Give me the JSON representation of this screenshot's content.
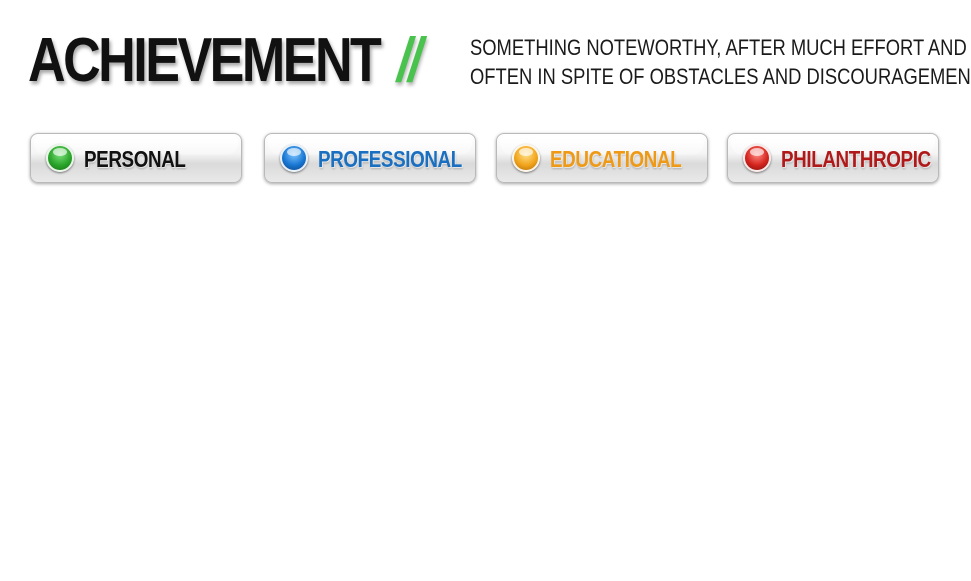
{
  "header": {
    "title": "ACHIEVEMENT",
    "separator": "//",
    "definition_line1": "SOMETHING NOTEWORTHY, AFTER MUCH EFFORT AND",
    "definition_line2": "OFTEN IN SPITE OF OBSTACLES AND DISCOURAGEMENTS."
  },
  "colors": {
    "title": "#111111",
    "separator": "#49c24e"
  },
  "categories": [
    {
      "id": "personal",
      "label": "PERSONAL",
      "icon": "green-orb-icon",
      "orb_color": "#2aa52a",
      "text_color": "#111111"
    },
    {
      "id": "professional",
      "label": "PROFESSIONAL",
      "icon": "blue-orb-icon",
      "orb_color": "#1877d2",
      "text_color": "#1a6fc0"
    },
    {
      "id": "educational",
      "label": "EDUCATIONAL",
      "icon": "orange-orb-icon",
      "orb_color": "#f2a51c",
      "text_color": "#ee9a17"
    },
    {
      "id": "philanthropic",
      "label": "PHILANTHROPIC",
      "icon": "red-orb-icon",
      "orb_color": "#d4251e",
      "text_color": "#b0191a"
    }
  ]
}
